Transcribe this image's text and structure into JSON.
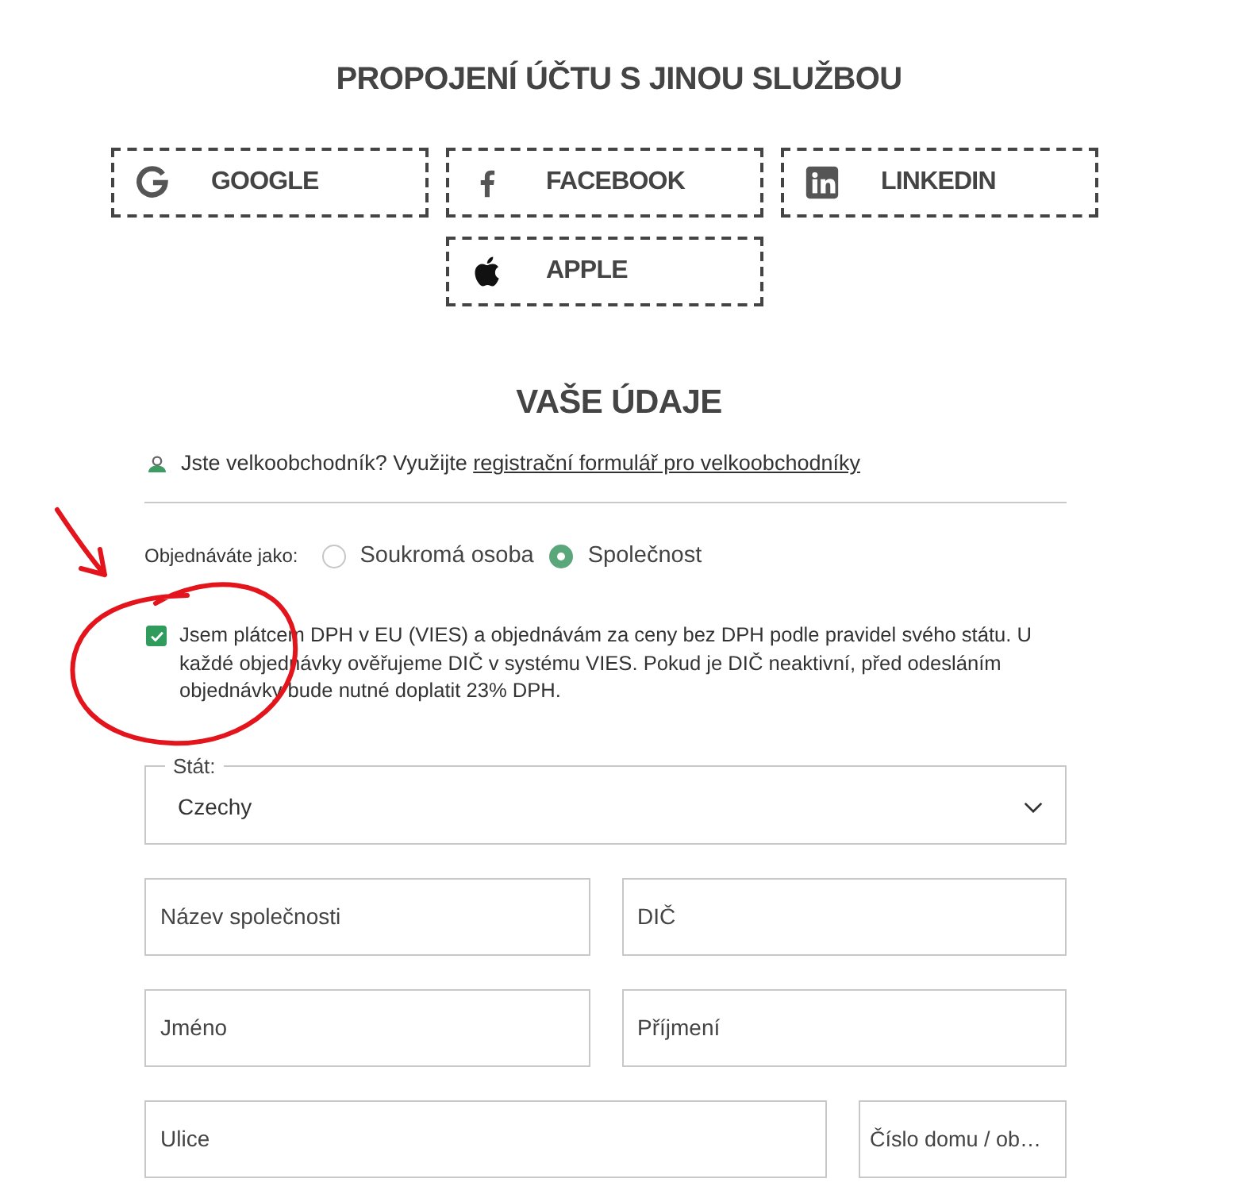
{
  "social_login": {
    "title": "PROPOJENÍ ÚČTU S JINOU SLUŽBOU",
    "buttons": [
      {
        "kind": "google",
        "label": "GOOGLE"
      },
      {
        "kind": "facebook",
        "label": "FACEBOOK"
      },
      {
        "kind": "linkedin",
        "label": "LINKEDIN"
      },
      {
        "kind": "apple",
        "label": "APPLE"
      }
    ]
  },
  "details": {
    "title": "VAŠE ÚDAJE",
    "wholesale_note": {
      "text": "Jste velkoobchodník? Využijte ",
      "link": "registrační formulář pro velkoobchodníky"
    },
    "customer_type": {
      "label": "Objednáváte jako:",
      "options": [
        {
          "label": "Soukromá osoba",
          "selected": false
        },
        {
          "label": "Společnost",
          "selected": true
        }
      ]
    },
    "vat_checkbox": {
      "checked": true,
      "text": "Jsem plátcem DPH v EU (VIES) a objednávám za ceny bez DPH podle pravidel svého státu. U každé objednávky ověřujeme DIČ v systému VIES. Pokud je DIČ neaktivní, před odesláním objednávky bude nutné doplatit 23% DPH."
    },
    "country": {
      "label": "Stát:",
      "value": "Czechy"
    },
    "field_rows": [
      [
        {
          "placeholder": "Název společnosti"
        },
        {
          "placeholder": "DIČ"
        }
      ],
      [
        {
          "placeholder": "Jméno"
        },
        {
          "placeholder": "Příjmení"
        }
      ],
      [
        {
          "placeholder": "Ulice"
        },
        {
          "placeholder": "Číslo domu / ob…"
        }
      ]
    ]
  }
}
